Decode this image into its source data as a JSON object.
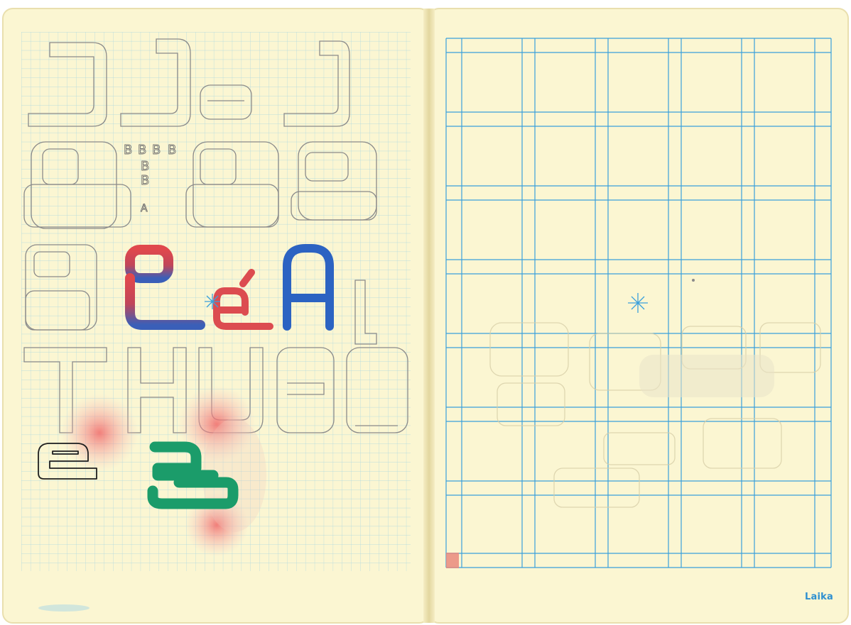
{
  "brand": {
    "name": "Laika"
  },
  "sketch_letters": {
    "small_b_row": [
      "B",
      "B",
      "B",
      "B"
    ],
    "small_a": "A"
  },
  "colors": {
    "paper": "#fbf6d2",
    "paper_edge": "#efe6b5",
    "grid_fine": "#a9d6e0",
    "grid_blue": "#3aa0dc",
    "pencil": "#8a8a8a",
    "red": "#d9494d",
    "blue": "#2a63c0",
    "green": "#1b9c6a",
    "pink_blot": "#f08a8a",
    "brand": "#2e8fd0"
  }
}
